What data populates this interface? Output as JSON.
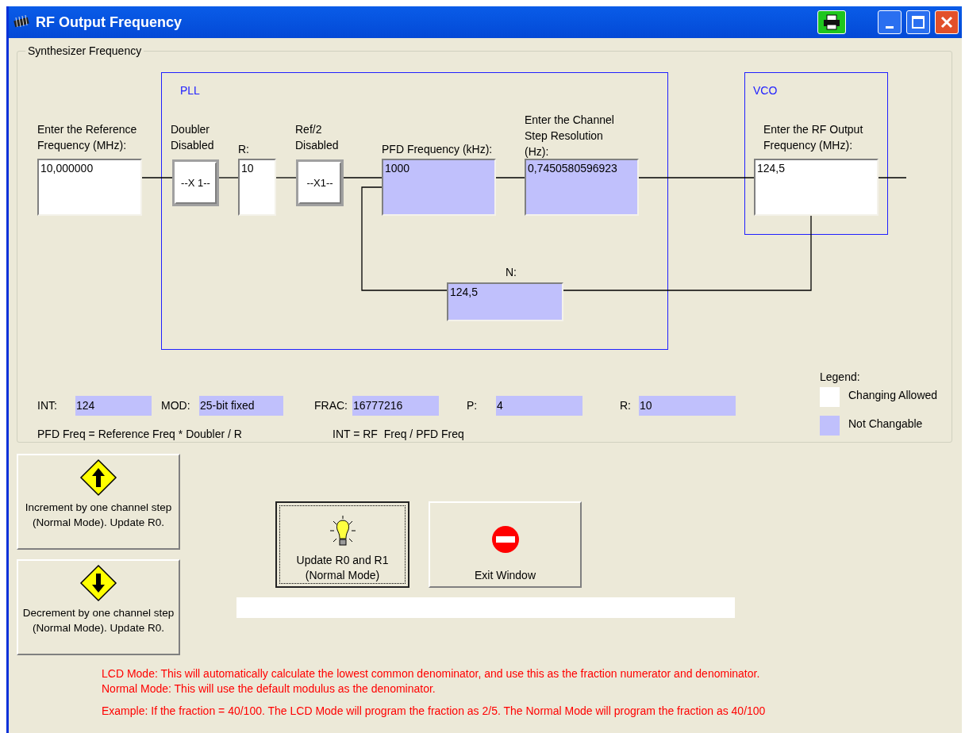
{
  "window": {
    "title": "RF Output Frequency"
  },
  "group": {
    "title": "Synthesizer Frequency"
  },
  "blocks": [
    {
      "label": "PLL"
    },
    {
      "label": "VCO"
    }
  ],
  "diagram": [
    {
      "kind": "field",
      "label": "Enter the Reference Frequency (MHz):",
      "value": "10,000000",
      "editable": true
    },
    {
      "kind": "switch",
      "label": "Doubler Disabled",
      "button": "--X 1--"
    },
    {
      "kind": "field",
      "label": "R:",
      "value": "10",
      "editable": true
    },
    {
      "kind": "switch",
      "label": "Ref/2 Disabled",
      "button": "--X1--"
    },
    {
      "kind": "field",
      "label": "PFD Frequency (kHz):",
      "value": "1000",
      "editable": false
    },
    {
      "kind": "field",
      "label": "Enter the Channel Step Resolution (Hz):",
      "value": "0,7450580596923",
      "editable": false
    },
    {
      "kind": "field",
      "label": "Enter the RF Output Frequency (MHz):",
      "value": "124,5",
      "editable": true
    },
    {
      "kind": "field",
      "label": "N:",
      "value": "124,5",
      "editable": false
    }
  ],
  "summary": [
    {
      "label": "INT:",
      "value": "124",
      "editable": false
    },
    {
      "label": "MOD:",
      "value": "25-bit fixed",
      "editable": false
    },
    {
      "label": "FRAC:",
      "value": "16777216",
      "editable": false
    },
    {
      "label": "P:",
      "value": "4",
      "editable": false
    },
    {
      "label": "R:",
      "value": "10",
      "editable": false
    }
  ],
  "formulas": [
    "PFD Freq = Reference Freq * Doubler / R",
    "INT = RF  Freq / PFD Freq"
  ],
  "legend": {
    "title": "Legend:",
    "items": [
      {
        "label": "Changing Allowed",
        "editable": true
      },
      {
        "label": "Not Changable",
        "editable": false
      }
    ]
  },
  "step_buttons": [
    {
      "kind": "up",
      "label": "Increment by one channel step (Normal Mode). Update R0."
    },
    {
      "kind": "down",
      "label": "Decrement by one channel step  (Normal Mode). Update R0."
    }
  ],
  "actions": [
    {
      "kind": "update",
      "label": "Update R0 and R1 (Normal Mode)",
      "focused": true
    },
    {
      "kind": "exit",
      "label": "Exit Window",
      "focused": false
    }
  ],
  "notes": [
    "LCD Mode: This will automatically calculate the lowest common denominator, and use this as the fraction numerator and denominator.",
    "Normal Mode: This will use the default modulus as the denominator.",
    "Example: If the fraction = 40/100. The LCD Mode will program the fraction as 2/5. The Normal Mode will program the fraction as 40/100"
  ]
}
